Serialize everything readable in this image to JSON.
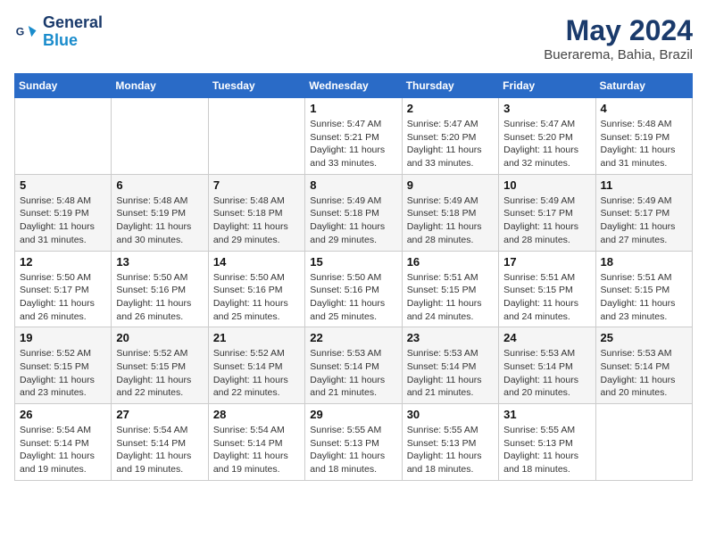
{
  "header": {
    "logo_line1": "General",
    "logo_line2": "Blue",
    "month_title": "May 2024",
    "subtitle": "Buerarema, Bahia, Brazil"
  },
  "days_of_week": [
    "Sunday",
    "Monday",
    "Tuesday",
    "Wednesday",
    "Thursday",
    "Friday",
    "Saturday"
  ],
  "weeks": [
    [
      {
        "day": "",
        "info": ""
      },
      {
        "day": "",
        "info": ""
      },
      {
        "day": "",
        "info": ""
      },
      {
        "day": "1",
        "info": "Sunrise: 5:47 AM\nSunset: 5:21 PM\nDaylight: 11 hours\nand 33 minutes."
      },
      {
        "day": "2",
        "info": "Sunrise: 5:47 AM\nSunset: 5:20 PM\nDaylight: 11 hours\nand 33 minutes."
      },
      {
        "day": "3",
        "info": "Sunrise: 5:47 AM\nSunset: 5:20 PM\nDaylight: 11 hours\nand 32 minutes."
      },
      {
        "day": "4",
        "info": "Sunrise: 5:48 AM\nSunset: 5:19 PM\nDaylight: 11 hours\nand 31 minutes."
      }
    ],
    [
      {
        "day": "5",
        "info": "Sunrise: 5:48 AM\nSunset: 5:19 PM\nDaylight: 11 hours\nand 31 minutes."
      },
      {
        "day": "6",
        "info": "Sunrise: 5:48 AM\nSunset: 5:19 PM\nDaylight: 11 hours\nand 30 minutes."
      },
      {
        "day": "7",
        "info": "Sunrise: 5:48 AM\nSunset: 5:18 PM\nDaylight: 11 hours\nand 29 minutes."
      },
      {
        "day": "8",
        "info": "Sunrise: 5:49 AM\nSunset: 5:18 PM\nDaylight: 11 hours\nand 29 minutes."
      },
      {
        "day": "9",
        "info": "Sunrise: 5:49 AM\nSunset: 5:18 PM\nDaylight: 11 hours\nand 28 minutes."
      },
      {
        "day": "10",
        "info": "Sunrise: 5:49 AM\nSunset: 5:17 PM\nDaylight: 11 hours\nand 28 minutes."
      },
      {
        "day": "11",
        "info": "Sunrise: 5:49 AM\nSunset: 5:17 PM\nDaylight: 11 hours\nand 27 minutes."
      }
    ],
    [
      {
        "day": "12",
        "info": "Sunrise: 5:50 AM\nSunset: 5:17 PM\nDaylight: 11 hours\nand 26 minutes."
      },
      {
        "day": "13",
        "info": "Sunrise: 5:50 AM\nSunset: 5:16 PM\nDaylight: 11 hours\nand 26 minutes."
      },
      {
        "day": "14",
        "info": "Sunrise: 5:50 AM\nSunset: 5:16 PM\nDaylight: 11 hours\nand 25 minutes."
      },
      {
        "day": "15",
        "info": "Sunrise: 5:50 AM\nSunset: 5:16 PM\nDaylight: 11 hours\nand 25 minutes."
      },
      {
        "day": "16",
        "info": "Sunrise: 5:51 AM\nSunset: 5:15 PM\nDaylight: 11 hours\nand 24 minutes."
      },
      {
        "day": "17",
        "info": "Sunrise: 5:51 AM\nSunset: 5:15 PM\nDaylight: 11 hours\nand 24 minutes."
      },
      {
        "day": "18",
        "info": "Sunrise: 5:51 AM\nSunset: 5:15 PM\nDaylight: 11 hours\nand 23 minutes."
      }
    ],
    [
      {
        "day": "19",
        "info": "Sunrise: 5:52 AM\nSunset: 5:15 PM\nDaylight: 11 hours\nand 23 minutes."
      },
      {
        "day": "20",
        "info": "Sunrise: 5:52 AM\nSunset: 5:15 PM\nDaylight: 11 hours\nand 22 minutes."
      },
      {
        "day": "21",
        "info": "Sunrise: 5:52 AM\nSunset: 5:14 PM\nDaylight: 11 hours\nand 22 minutes."
      },
      {
        "day": "22",
        "info": "Sunrise: 5:53 AM\nSunset: 5:14 PM\nDaylight: 11 hours\nand 21 minutes."
      },
      {
        "day": "23",
        "info": "Sunrise: 5:53 AM\nSunset: 5:14 PM\nDaylight: 11 hours\nand 21 minutes."
      },
      {
        "day": "24",
        "info": "Sunrise: 5:53 AM\nSunset: 5:14 PM\nDaylight: 11 hours\nand 20 minutes."
      },
      {
        "day": "25",
        "info": "Sunrise: 5:53 AM\nSunset: 5:14 PM\nDaylight: 11 hours\nand 20 minutes."
      }
    ],
    [
      {
        "day": "26",
        "info": "Sunrise: 5:54 AM\nSunset: 5:14 PM\nDaylight: 11 hours\nand 19 minutes."
      },
      {
        "day": "27",
        "info": "Sunrise: 5:54 AM\nSunset: 5:14 PM\nDaylight: 11 hours\nand 19 minutes."
      },
      {
        "day": "28",
        "info": "Sunrise: 5:54 AM\nSunset: 5:14 PM\nDaylight: 11 hours\nand 19 minutes."
      },
      {
        "day": "29",
        "info": "Sunrise: 5:55 AM\nSunset: 5:13 PM\nDaylight: 11 hours\nand 18 minutes."
      },
      {
        "day": "30",
        "info": "Sunrise: 5:55 AM\nSunset: 5:13 PM\nDaylight: 11 hours\nand 18 minutes."
      },
      {
        "day": "31",
        "info": "Sunrise: 5:55 AM\nSunset: 5:13 PM\nDaylight: 11 hours\nand 18 minutes."
      },
      {
        "day": "",
        "info": ""
      }
    ]
  ]
}
